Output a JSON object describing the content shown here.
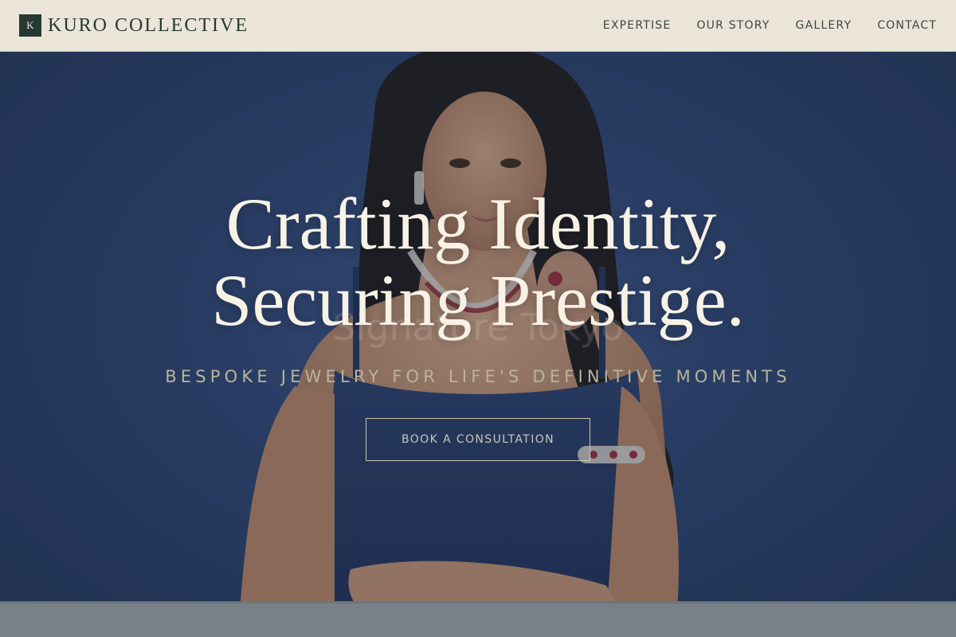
{
  "header": {
    "logo_letter": "K",
    "brand": "KURO COLLECTIVE",
    "nav": [
      {
        "label": "EXPERTISE"
      },
      {
        "label": "OUR STORY"
      },
      {
        "label": "GALLERY"
      },
      {
        "label": "CONTACT"
      }
    ]
  },
  "hero": {
    "title_line1": "Crafting Identity,",
    "title_line2": "Securing Prestige.",
    "subtitle": "BESPOKE JEWELRY FOR LIFE'S DEFINITIVE MOMENTS",
    "cta_label": "BOOK A CONSULTATION",
    "watermark": "Signature Tokyo"
  },
  "colors": {
    "header_bg": "#ebe5d9",
    "brand_green": "#26382f",
    "hero_blue": "#2d4372",
    "title_cream": "#f8f2e6",
    "subtitle_olive": "#b9b49b"
  }
}
